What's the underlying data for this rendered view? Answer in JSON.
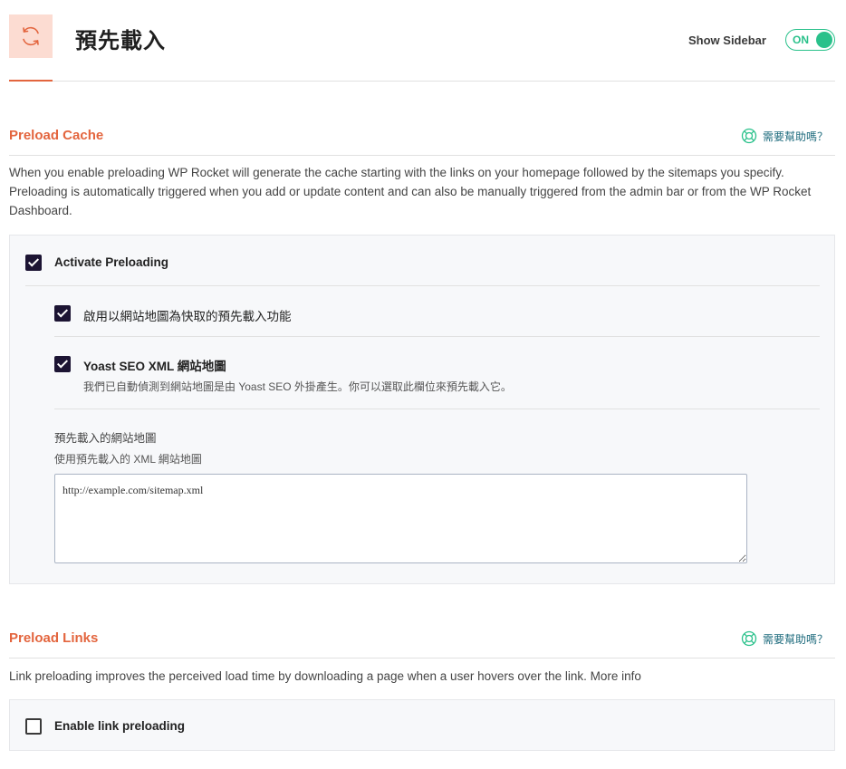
{
  "header": {
    "title": "預先載入",
    "icon": "refresh-icon",
    "show_sidebar_label": "Show Sidebar",
    "toggle_state": "ON"
  },
  "colors": {
    "accent": "#e3653e",
    "accent_light": "#fcdcd2",
    "toggle_green": "#2ac18b",
    "checkbox_dark": "#1c1433",
    "help_link": "#1e6b7d"
  },
  "preload_cache": {
    "title": "Preload Cache",
    "help_label": "需要幫助嗎？",
    "description": "When you enable preloading WP Rocket will generate the cache starting with the links on your homepage followed by the sitemaps you specify. Preloading is automatically triggered when you add or update content and can also be manually triggered from the admin bar or from the WP Rocket Dashboard.",
    "activate_label": "Activate Preloading",
    "activate_checked": true,
    "sitemap_option_label": "啟用以網站地圖為快取的預先載入功能",
    "sitemap_option_checked": true,
    "yoast_label": "Yoast SEO XML 網站地圖",
    "yoast_checked": true,
    "yoast_desc": "我們已自動偵測到網站地圖是由 Yoast SEO 外掛產生。你可以選取此欄位來預先載入它。",
    "sitemaps_title": "預先載入的網站地圖",
    "sitemaps_desc": "使用預先載入的 XML 網站地圖",
    "sitemaps_value": "http://example.com/sitemap.xml"
  },
  "preload_links": {
    "title": "Preload Links",
    "help_label": "需要幫助嗎？",
    "description": "Link preloading improves the perceived load time by downloading a page when a user hovers over the link. More info",
    "enable_label": "Enable link preloading",
    "enable_checked": false
  }
}
